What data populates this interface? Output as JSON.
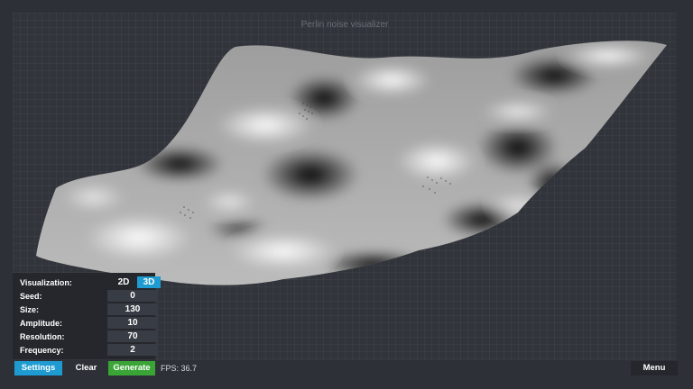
{
  "app": {
    "title": "Perlin noise visualizer"
  },
  "settings": {
    "visualization": {
      "label": "Visualization:",
      "options": [
        "2D",
        "3D"
      ],
      "selected": "3D"
    },
    "seed": {
      "label": "Seed:",
      "value": "0"
    },
    "size": {
      "label": "Size:",
      "value": "130"
    },
    "amplitude": {
      "label": "Amplitude:",
      "value": "10"
    },
    "resolution": {
      "label": "Resolution:",
      "value": "70"
    },
    "frequency": {
      "label": "Frequency:",
      "value": "2"
    }
  },
  "toolbar": {
    "settings_label": "Settings",
    "clear_label": "Clear",
    "generate_label": "Generate",
    "fps_text": "FPS: 36.7",
    "menu_label": "Menu"
  },
  "colors": {
    "accent": "#1e9bd0",
    "generate": "#3aa536",
    "background": "#2d3037",
    "panel": "#25272d"
  }
}
